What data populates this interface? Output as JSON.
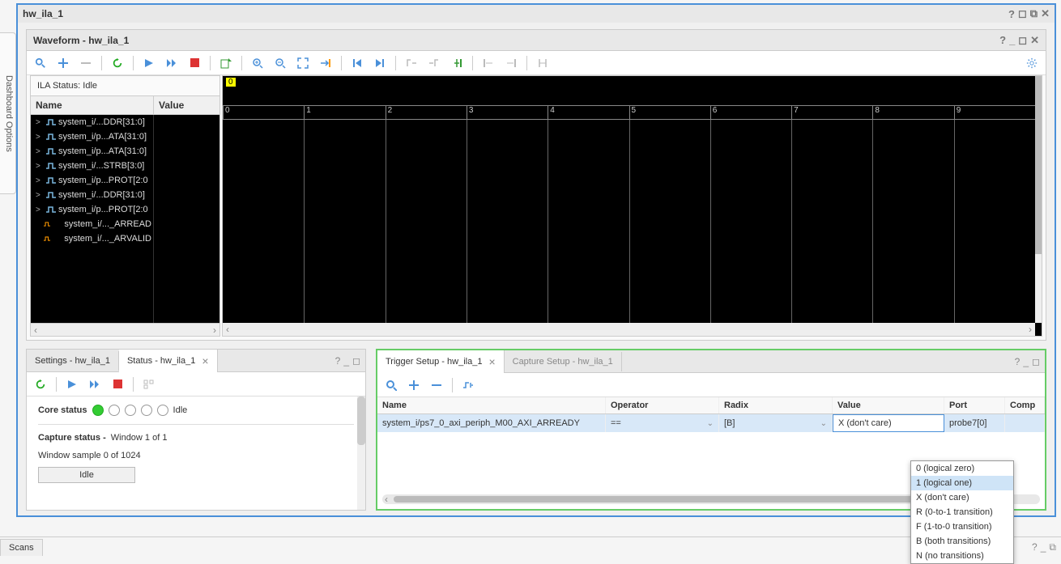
{
  "sidebar": {
    "label": "Dashboard Options"
  },
  "window": {
    "title": "hw_ila_1"
  },
  "waveform": {
    "title": "Waveform - hw_ila_1",
    "ila_status_label": "ILA Status:",
    "ila_status_value": "Idle",
    "col_name": "Name",
    "col_value": "Value",
    "marker": "0",
    "ticks": [
      "0",
      "1",
      "2",
      "3",
      "4",
      "5",
      "6",
      "7",
      "8",
      "9"
    ],
    "signals": [
      {
        "expand": true,
        "name": "system_i/...DDR[31:0]"
      },
      {
        "expand": true,
        "name": "system_i/p...ATA[31:0]"
      },
      {
        "expand": true,
        "name": "system_i/p...ATA[31:0]"
      },
      {
        "expand": true,
        "name": "system_i/...STRB[3:0]"
      },
      {
        "expand": true,
        "name": "system_i/p...PROT[2:0"
      },
      {
        "expand": true,
        "name": "system_i/...DDR[31:0]"
      },
      {
        "expand": true,
        "name": "system_i/p...PROT[2:0"
      },
      {
        "expand": false,
        "name": "system_i/..._ARREAD"
      },
      {
        "expand": false,
        "name": "system_i/..._ARVALID"
      }
    ]
  },
  "status_panel": {
    "tabs": [
      {
        "label": "Settings - hw_ila_1",
        "closable": false
      },
      {
        "label": "Status - hw_ila_1",
        "closable": true
      }
    ],
    "active_tab": 1,
    "core_status_label": "Core status",
    "core_status_text": "Idle",
    "capture_status_label": "Capture status -",
    "capture_status_value": "Window 1 of 1",
    "window_sample": "Window sample 0 of 1024",
    "idle_button": "Idle"
  },
  "trigger_panel": {
    "tabs": [
      {
        "label": "Trigger Setup - hw_ila_1",
        "closable": true
      },
      {
        "label": "Capture Setup - hw_ila_1",
        "closable": false
      }
    ],
    "active_tab": 0,
    "cols": {
      "name": "Name",
      "operator": "Operator",
      "radix": "Radix",
      "value": "Value",
      "port": "Port",
      "comp": "Comp"
    },
    "row": {
      "name": "system_i/ps7_0_axi_periph_M00_AXI_ARREADY",
      "operator": "==",
      "radix": "[B]",
      "value": "X (don't care)",
      "port": "probe7[0]"
    },
    "value_options": [
      "0 (logical zero)",
      "1 (logical one)",
      "X (don't care)",
      "R (0-to-1 transition)",
      "F (1-to-0 transition)",
      "B (both transitions)",
      "N (no transitions)"
    ],
    "value_selected_index": 1
  },
  "footer": {
    "tab": "Scans"
  }
}
